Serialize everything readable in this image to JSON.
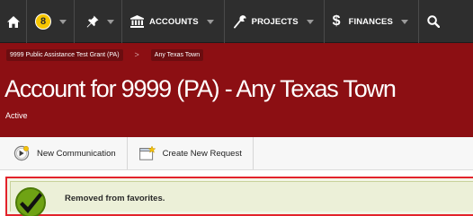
{
  "nav": {
    "home_icon": "home-icon",
    "badge_count": "8",
    "pin_icon": "pin-icon",
    "accounts_label": "ACCOUNTS",
    "projects_label": "PROJECTS",
    "finances_label": "FINANCES",
    "search_icon": "search-icon"
  },
  "breadcrumb": {
    "items": [
      "9999 Public Assistance Test Grant (PA)",
      "Any Texas Town"
    ],
    "separator": ">"
  },
  "header": {
    "title": "Account for 9999 (PA) - Any Texas Town",
    "status": "Active",
    "background_color": "#8c0f13"
  },
  "toolbar": {
    "new_communication_label": "New Communication",
    "create_request_label": "Create New Request"
  },
  "notification": {
    "message": "Removed from favorites.",
    "border_color": "#e2232b"
  }
}
